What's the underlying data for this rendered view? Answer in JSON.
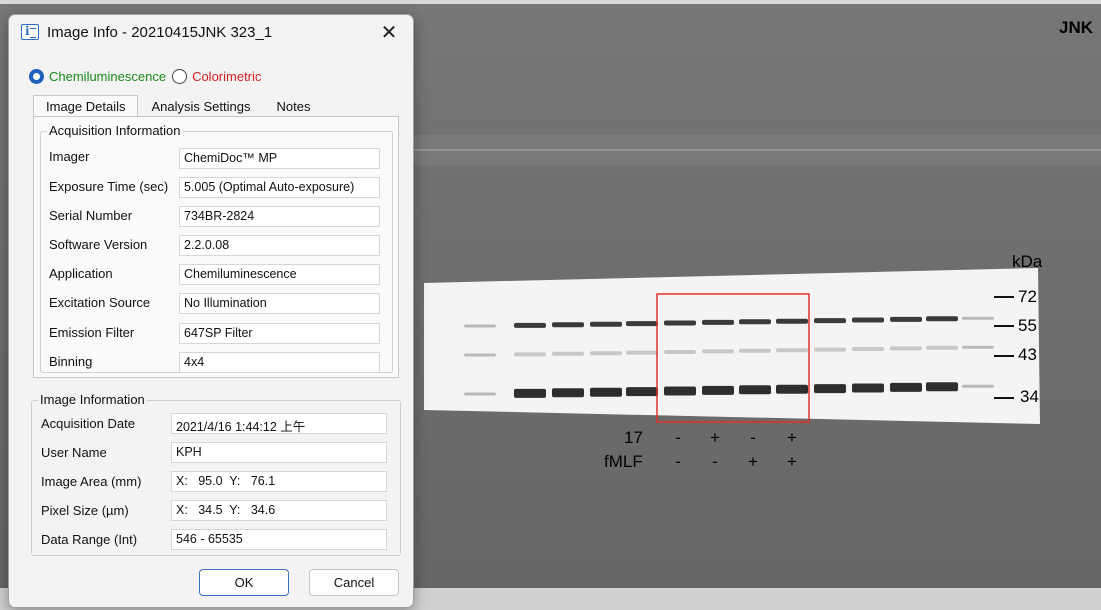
{
  "blot": {
    "title": "JNK",
    "unit_label": "kDa",
    "markers": [
      "72",
      "55",
      "43",
      "34"
    ],
    "rows": [
      {
        "label": "17",
        "signs": [
          "-",
          "+",
          "-",
          "+"
        ]
      },
      {
        "label": "fMLF",
        "signs": [
          "-",
          "-",
          "+",
          "+"
        ]
      }
    ],
    "highlight_color": "#e0322d"
  },
  "dialog": {
    "title": "Image Info - 20210415JNK 323_1",
    "close_icon": "close-icon",
    "modes": [
      {
        "label": "Chemiluminescence",
        "selected": true,
        "color": "#1a8a1a"
      },
      {
        "label": "Colorimetric",
        "selected": false,
        "color": "#d21e1e"
      }
    ],
    "tabs": [
      "Image Details",
      "Analysis Settings",
      "Notes"
    ],
    "active_tab": "Image Details",
    "acquisition": {
      "legend": "Acquisition Information",
      "fields": [
        {
          "label": "Imager",
          "value": "ChemiDoc™ MP"
        },
        {
          "label": "Exposure Time (sec)",
          "value": "5.005 (Optimal Auto-exposure)"
        },
        {
          "label": "Serial Number",
          "value": "734BR-2824"
        },
        {
          "label": "Software Version",
          "value": "2.2.0.08"
        },
        {
          "label": "Application",
          "value": "Chemiluminescence"
        },
        {
          "label": "Excitation Source",
          "value": "No Illumination"
        },
        {
          "label": "Emission Filter",
          "value": "647SP Filter"
        },
        {
          "label": "Binning",
          "value": "4x4"
        }
      ]
    },
    "image_info": {
      "legend": "Image Information",
      "fields": [
        {
          "label": "Acquisition Date",
          "value": "2021/4/16 1:44:12 上午"
        },
        {
          "label": "User Name",
          "value": "KPH"
        },
        {
          "label": "Image Area (mm)",
          "value": "X:   95.0  Y:   76.1"
        },
        {
          "label": "Pixel Size (µm)",
          "value": "X:   34.5  Y:   34.6"
        },
        {
          "label": "Data Range (Int)",
          "value": "546 - 65535"
        }
      ]
    },
    "ok_label": "OK",
    "cancel_label": "Cancel"
  }
}
